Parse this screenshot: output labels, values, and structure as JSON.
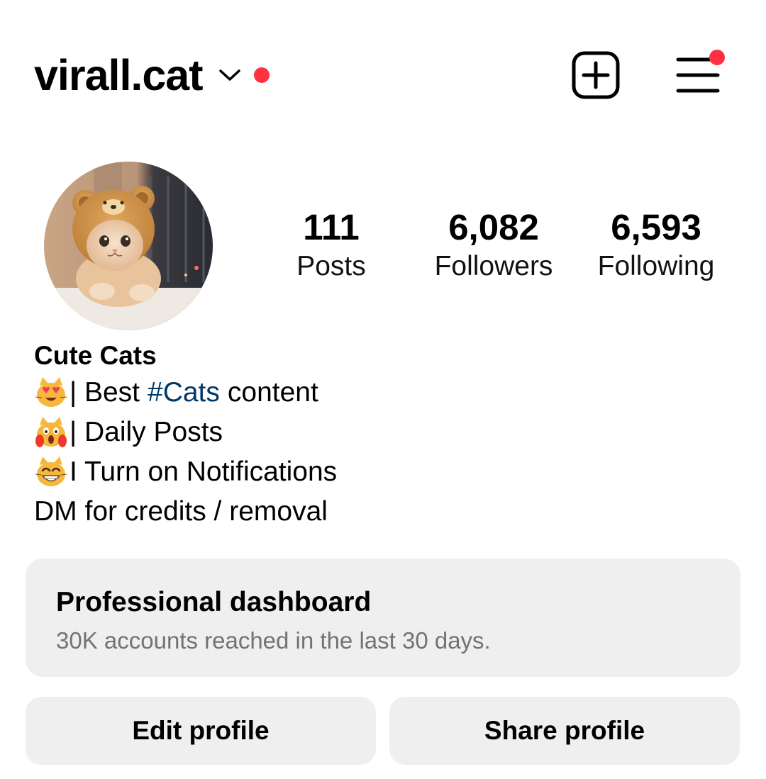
{
  "header": {
    "username": "virall.cat",
    "accent_color": "#ff3040",
    "icons": [
      "chevron-down-icon",
      "new-post-icon",
      "menu-icon"
    ]
  },
  "stats": {
    "posts": {
      "value": "111",
      "label": "Posts"
    },
    "followers": {
      "value": "6,082",
      "label": "Followers"
    },
    "following": {
      "value": "6,593",
      "label": "Following"
    }
  },
  "bio": {
    "name": "Cute Cats",
    "line1": {
      "emoji": "smiling-cat-heart-eyes-emoji",
      "prefix": "| Best",
      "hashtag": "#Cats",
      "suffix": "content"
    },
    "line2": {
      "emoji": "weary-cat-emoji",
      "text": "| Daily Posts"
    },
    "line3": {
      "emoji": "grinning-cat-emoji",
      "text": "I Turn on Notifications"
    },
    "line4": "DM for credits / removal",
    "hashtag_color": "#00376b"
  },
  "dashboard": {
    "title": "Professional dashboard",
    "subtitle": "30K accounts reached in the last 30 days."
  },
  "buttons": {
    "edit": "Edit profile",
    "share": "Share profile"
  }
}
